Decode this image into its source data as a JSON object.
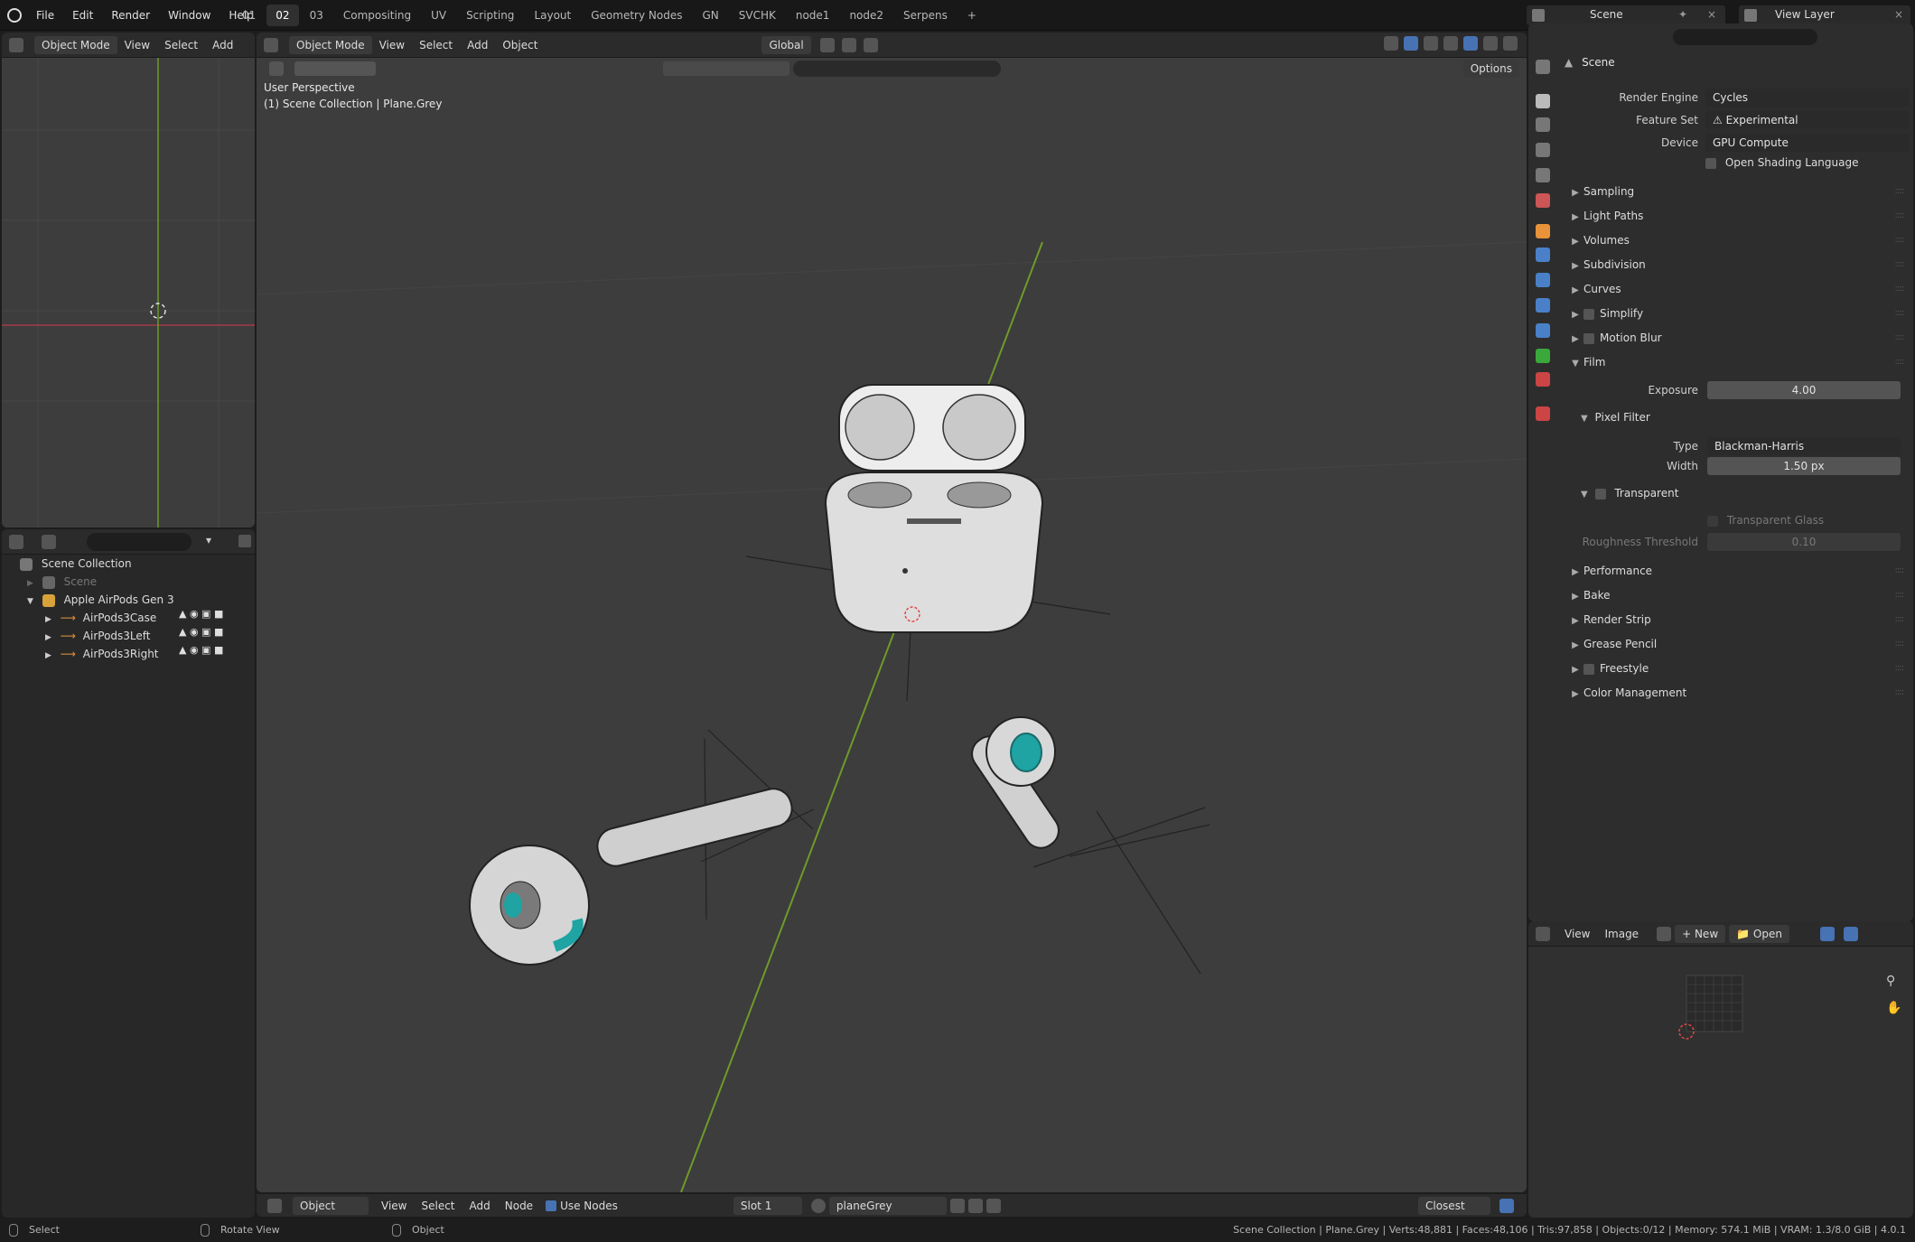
{
  "topbar": {
    "menus": [
      "File",
      "Edit",
      "Render",
      "Window",
      "Help"
    ],
    "workspaces": [
      "01",
      "02",
      "03",
      "Compositing",
      "UV",
      "Scripting",
      "Layout",
      "Geometry Nodes",
      "GN",
      "SVCHK",
      "node1",
      "node2",
      "Serpens"
    ],
    "active_workspace": "02",
    "add_tab": "+",
    "scene_name": "Scene",
    "view_layer": "View Layer"
  },
  "left_viewport": {
    "mode": "Object Mode",
    "menus": [
      "View",
      "Select",
      "Add"
    ]
  },
  "viewport": {
    "mode": "Object Mode",
    "menus": [
      "View",
      "Select",
      "Add",
      "Object"
    ],
    "transform": "Global",
    "options": "Options",
    "perspective": "User Perspective",
    "collection_info": "(1) Scene Collection | Plane.Grey"
  },
  "outliner": {
    "root": "Scene Collection",
    "rows": [
      {
        "label": "Scene",
        "dim": true
      },
      {
        "label": "Apple AirPods Gen 3",
        "dim": false
      },
      {
        "label": "AirPods3Case",
        "dim": false
      },
      {
        "label": "AirPods3Left",
        "dim": false
      },
      {
        "label": "AirPods3Right",
        "dim": false
      }
    ]
  },
  "properties": {
    "title": "Scene",
    "render_engine_label": "Render Engine",
    "render_engine": "Cycles",
    "feature_set_label": "Feature Set",
    "feature_set": "Experimental",
    "device_label": "Device",
    "device": "GPU Compute",
    "osl_label": "Open Shading Language",
    "panels_top": [
      "Sampling",
      "Light Paths",
      "Volumes",
      "Subdivision",
      "Curves",
      "Simplify",
      "Motion Blur",
      "Film"
    ],
    "exposure_label": "Exposure",
    "exposure": "4.00",
    "pixel_filter": "Pixel Filter",
    "type_label": "Type",
    "type": "Blackman-Harris",
    "width_label": "Width",
    "width": "1.50 px",
    "transparent": "Transparent",
    "transparent_glass": "Transparent Glass",
    "roughness_label": "Roughness Threshold",
    "roughness": "0.10",
    "panels_bottom": [
      "Performance",
      "Bake",
      "Render Strip",
      "Grease Pencil",
      "Freestyle",
      "Color Management"
    ]
  },
  "image_editor": {
    "menus": [
      "View",
      "Image"
    ],
    "new": "New",
    "open": "Open"
  },
  "node_header": {
    "object": "Object",
    "menus": [
      "View",
      "Select",
      "Add",
      "Node"
    ],
    "use_nodes": "Use Nodes",
    "slot": "Slot 1",
    "material": "planeGrey",
    "snap": "Closest"
  },
  "status": {
    "select": "Select",
    "rotate": "Rotate View",
    "object": "Object",
    "stats": "Scene Collection | Plane.Grey | Verts:48,881 | Faces:48,106 | Tris:97,858 | Objects:0/12 | Memory: 574.1 MiB | VRAM: 1.3/8.0 GiB | 4.0.1"
  },
  "colors": {
    "bg": "#1d1d1d",
    "viewport": "#3d3d3d",
    "accent": "#4772b3",
    "x_axis": "#a33b4a",
    "y_axis": "#6f9a2b",
    "teal": "#1fa3a3"
  }
}
